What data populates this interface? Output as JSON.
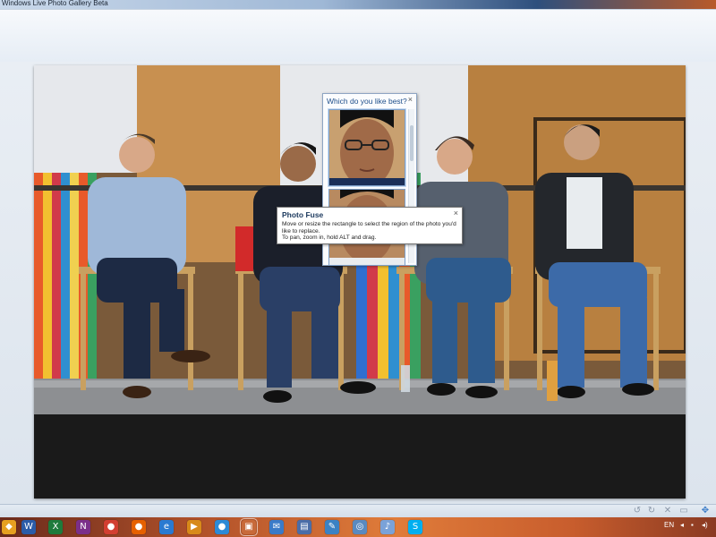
{
  "window": {
    "title": "Windows Live Photo Gallery Beta"
  },
  "choice_panel": {
    "header": "Which do you like best?",
    "close": "×"
  },
  "tooltip": {
    "title": "Photo Fuse",
    "line1": "Move or resize the rectangle to select the region of the photo you'd like to replace.",
    "line2": "To pan, zoom in, hold ALT and drag.",
    "close": "×"
  },
  "controls": {
    "undo": "↺",
    "redo": "↻",
    "delete": "✕",
    "view": "▭",
    "fit": "✥"
  },
  "taskbar": {
    "apps": [
      {
        "name": "start-icon",
        "glyph": "◆",
        "color": "#e6a020"
      },
      {
        "name": "word-icon",
        "glyph": "W",
        "color": "#2b5ca8"
      },
      {
        "name": "excel-icon",
        "glyph": "X",
        "color": "#1e7b3c"
      },
      {
        "name": "onenote-icon",
        "glyph": "N",
        "color": "#7b2f8a"
      },
      {
        "name": "chrome-icon",
        "glyph": "●",
        "color": "#d23f31"
      },
      {
        "name": "firefox-icon",
        "glyph": "●",
        "color": "#e66000"
      },
      {
        "name": "ie-icon",
        "glyph": "e",
        "color": "#2a7ad1"
      },
      {
        "name": "media-player-icon",
        "glyph": "▶",
        "color": "#d88a1a"
      },
      {
        "name": "wlm-icon",
        "glyph": "●",
        "color": "#2d8ad6"
      },
      {
        "name": "photo-gallery-icon",
        "glyph": "▣",
        "color": "#c86a3a"
      },
      {
        "name": "mail-icon",
        "glyph": "✉",
        "color": "#3a7bc8"
      },
      {
        "name": "movie-maker-icon",
        "glyph": "▤",
        "color": "#4a6da8"
      },
      {
        "name": "writer-icon",
        "glyph": "✎",
        "color": "#3b82c4"
      },
      {
        "name": "network-icon",
        "glyph": "◎",
        "color": "#5a8ac0"
      },
      {
        "name": "itunes-icon",
        "glyph": "♪",
        "color": "#7aa2d8"
      },
      {
        "name": "skype-icon",
        "glyph": "S",
        "color": "#00aff0"
      }
    ],
    "language": "EN"
  }
}
